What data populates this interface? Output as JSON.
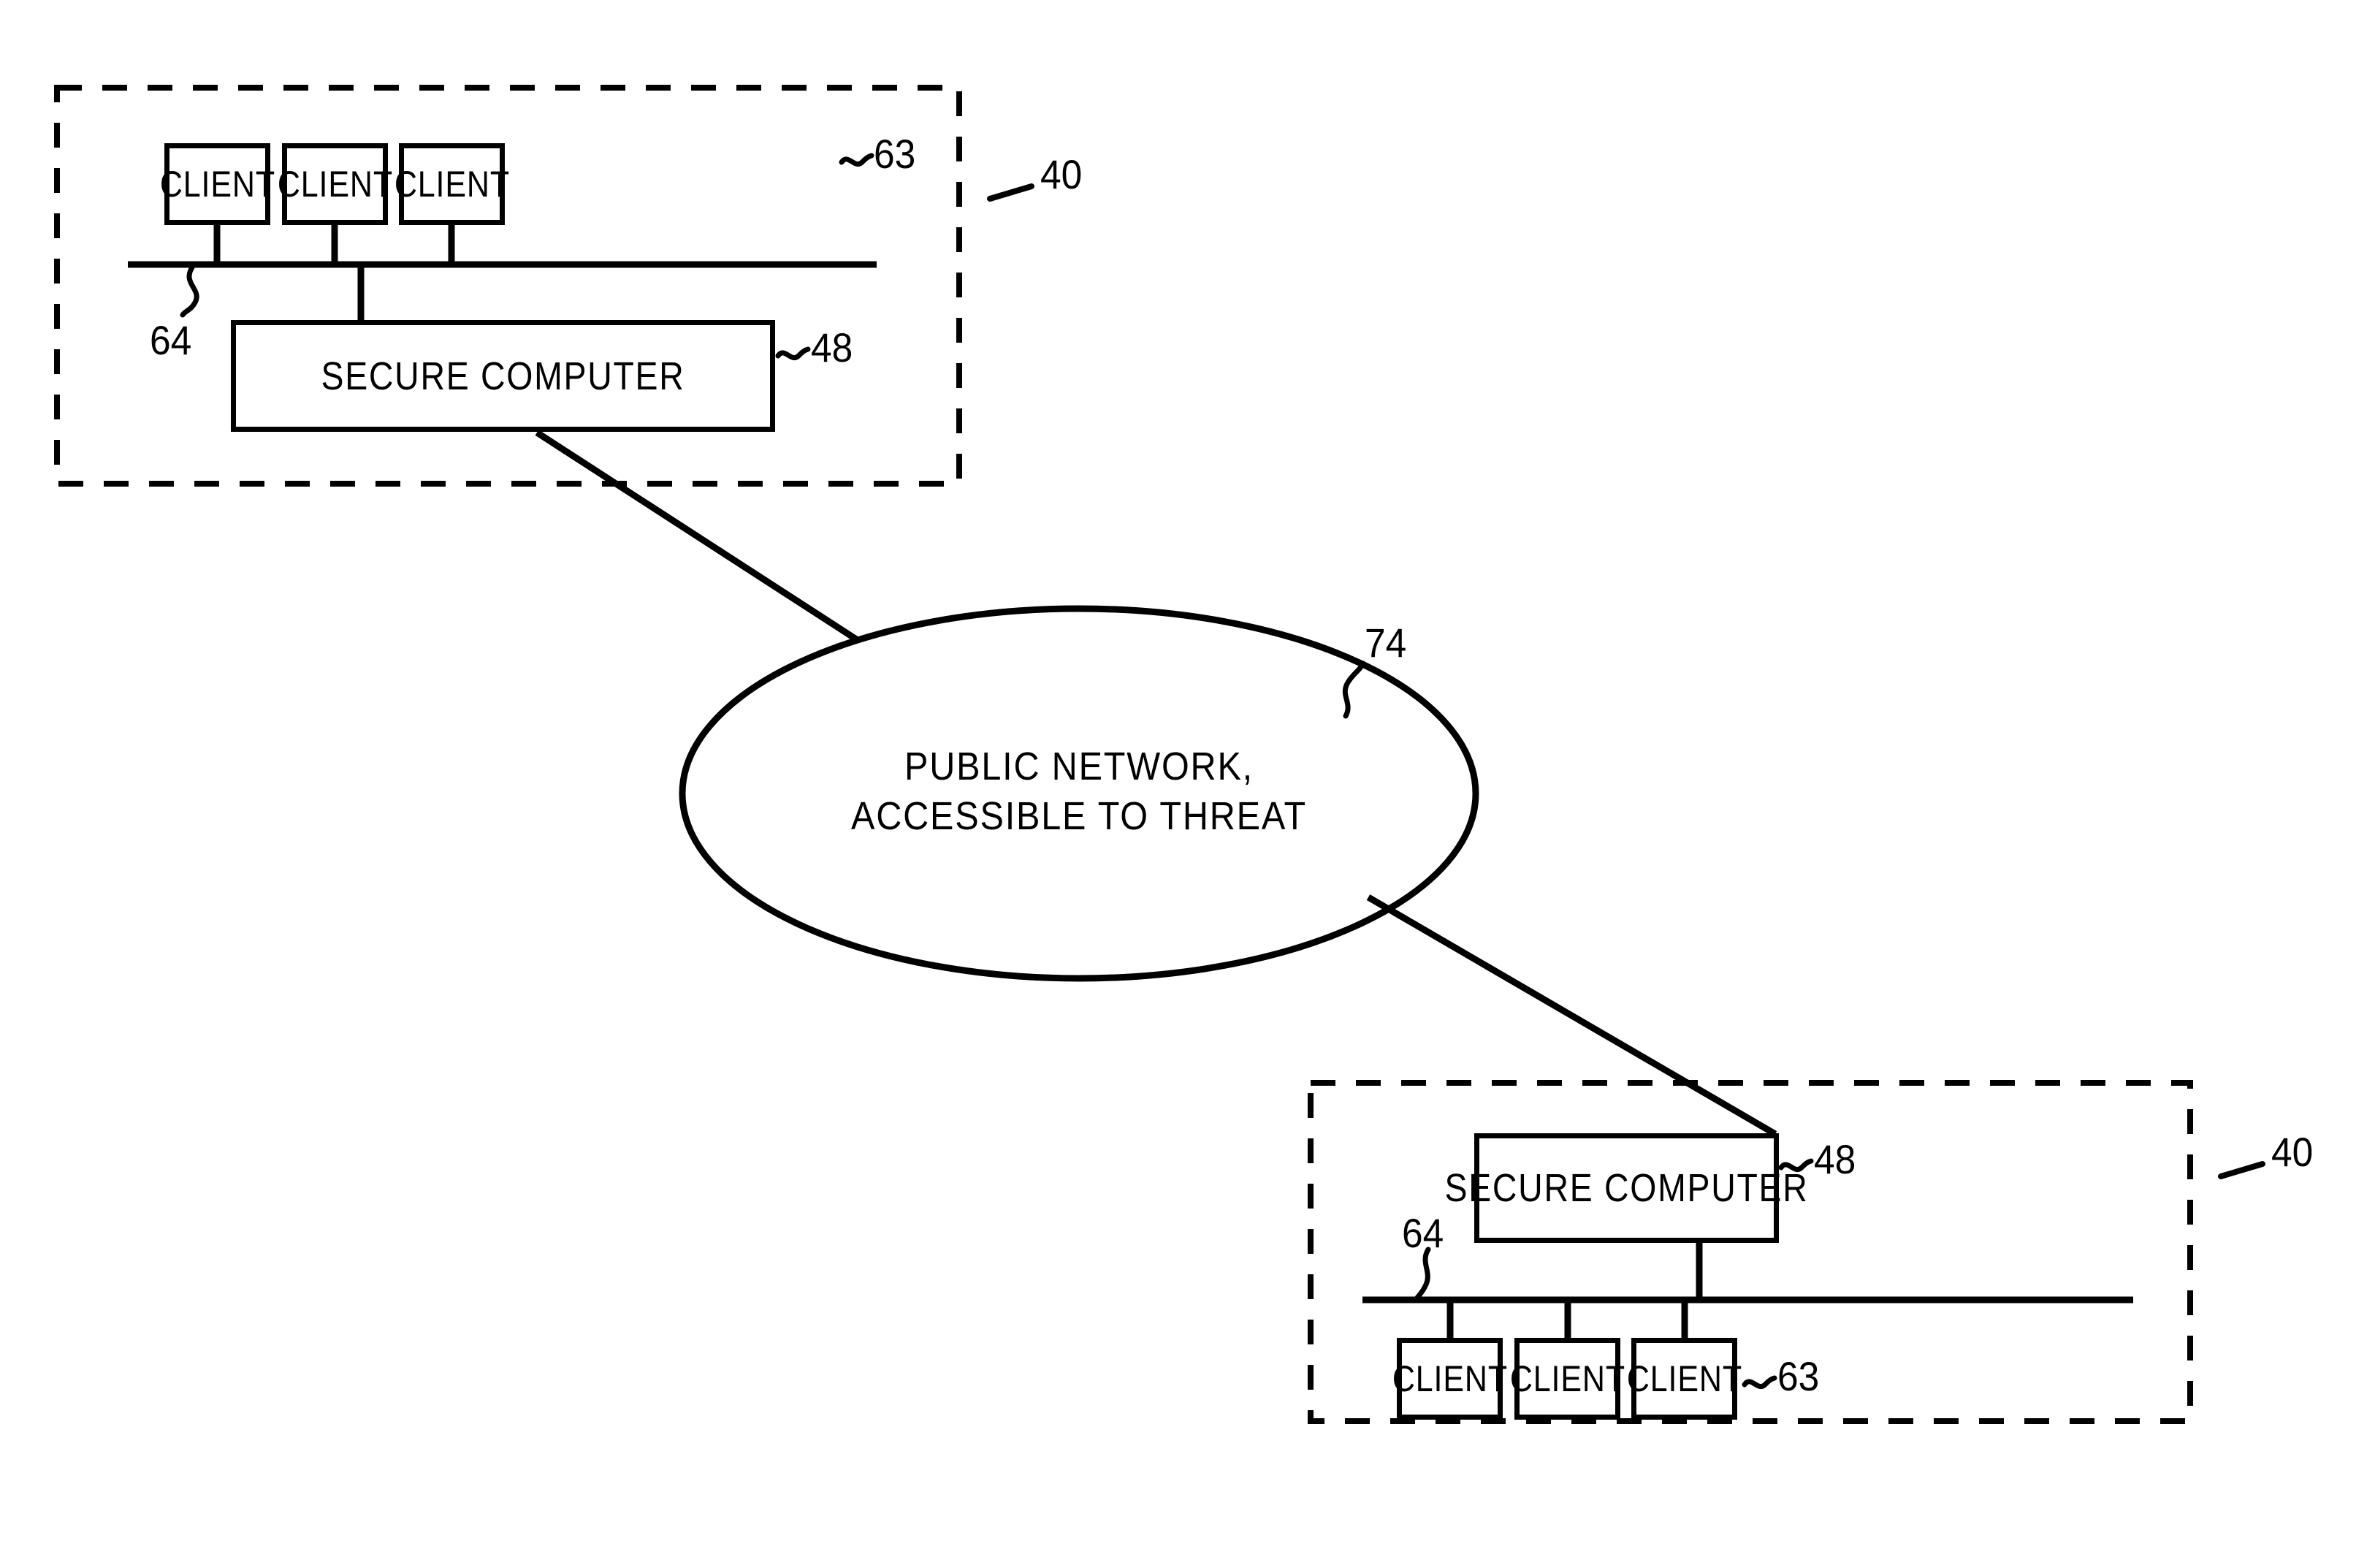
{
  "figure": {
    "type": "patent-network-diagram",
    "background_color": "#ffffff",
    "line_color": "#000000"
  },
  "network_cloud": {
    "name": "public-network",
    "shape": "ellipse",
    "label_line_1": "PUBLIC NETWORK,",
    "label_line_2": "ACCESSIBLE TO THREAT",
    "reference_numeral": "74"
  },
  "top_site": {
    "name": "secure-site-top",
    "reference_numeral": "40",
    "bus": {
      "reference_numeral": "64"
    },
    "clients": [
      {
        "label": "CLIENT"
      },
      {
        "label": "CLIENT"
      },
      {
        "label": "CLIENT"
      }
    ],
    "clients_reference_numeral": "63",
    "secure_computer": {
      "label": "SECURE  COMPUTER",
      "reference_numeral": "48"
    }
  },
  "bottom_site": {
    "name": "secure-site-bottom",
    "reference_numeral": "40",
    "bus": {
      "reference_numeral": "64"
    },
    "clients": [
      {
        "label": "CLIENT"
      },
      {
        "label": "CLIENT"
      },
      {
        "label": "CLIENT"
      }
    ],
    "clients_reference_numeral": "63",
    "secure_computer": {
      "label": "SECURE  COMPUTER",
      "reference_numeral": "48"
    }
  }
}
